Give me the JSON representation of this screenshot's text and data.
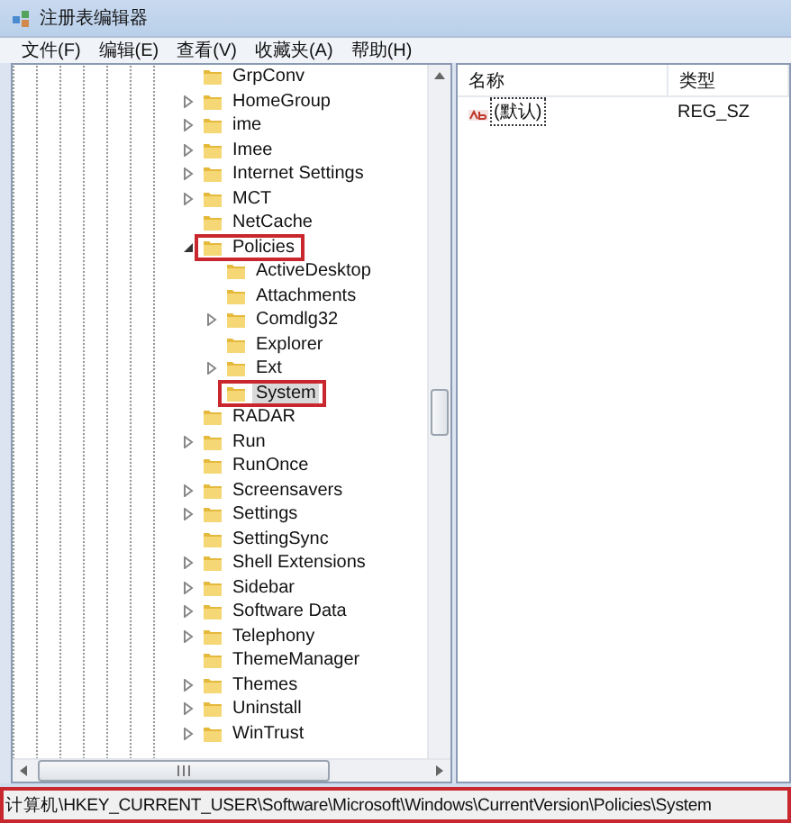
{
  "window": {
    "title": "注册表编辑器"
  },
  "menu": [
    "文件(F)",
    "编辑(E)",
    "查看(V)",
    "收藏夹(A)",
    "帮助(H)"
  ],
  "tree": [
    {
      "label": "GrpConv",
      "expandable": false,
      "selected": false,
      "highlighted": false
    },
    {
      "label": "HomeGroup",
      "expandable": true,
      "expanded": false,
      "selected": false,
      "highlighted": false
    },
    {
      "label": "ime",
      "expandable": true,
      "expanded": false,
      "selected": false,
      "highlighted": false
    },
    {
      "label": "Imee",
      "expandable": true,
      "expanded": false,
      "selected": false,
      "highlighted": false
    },
    {
      "label": "Internet Settings",
      "expandable": true,
      "expanded": false,
      "selected": false,
      "highlighted": false
    },
    {
      "label": "MCT",
      "expandable": true,
      "expanded": false,
      "selected": false,
      "highlighted": false
    },
    {
      "label": "NetCache",
      "expandable": false,
      "selected": false,
      "highlighted": false
    },
    {
      "label": "Policies",
      "expandable": true,
      "expanded": true,
      "selected": false,
      "highlighted": true,
      "children": [
        {
          "label": "ActiveDesktop",
          "expandable": false,
          "selected": false,
          "highlighted": false
        },
        {
          "label": "Attachments",
          "expandable": false,
          "selected": false,
          "highlighted": false
        },
        {
          "label": "Comdlg32",
          "expandable": true,
          "expanded": false,
          "selected": false,
          "highlighted": false
        },
        {
          "label": "Explorer",
          "expandable": false,
          "selected": false,
          "highlighted": false
        },
        {
          "label": "Ext",
          "expandable": true,
          "expanded": false,
          "selected": false,
          "highlighted": false
        },
        {
          "label": "System",
          "expandable": false,
          "selected": true,
          "highlighted": true
        }
      ]
    },
    {
      "label": "RADAR",
      "expandable": false,
      "selected": false,
      "highlighted": false
    },
    {
      "label": "Run",
      "expandable": true,
      "expanded": false,
      "selected": false,
      "highlighted": false
    },
    {
      "label": "RunOnce",
      "expandable": false,
      "selected": false,
      "highlighted": false
    },
    {
      "label": "Screensavers",
      "expandable": true,
      "expanded": false,
      "selected": false,
      "highlighted": false
    },
    {
      "label": "Settings",
      "expandable": true,
      "expanded": false,
      "selected": false,
      "highlighted": false
    },
    {
      "label": "SettingSync",
      "expandable": false,
      "selected": false,
      "highlighted": false
    },
    {
      "label": "Shell Extensions",
      "expandable": true,
      "expanded": false,
      "selected": false,
      "highlighted": false
    },
    {
      "label": "Sidebar",
      "expandable": true,
      "expanded": false,
      "selected": false,
      "highlighted": false
    },
    {
      "label": "Software Data",
      "expandable": true,
      "expanded": false,
      "selected": false,
      "highlighted": false
    },
    {
      "label": "Telephony",
      "expandable": true,
      "expanded": false,
      "selected": false,
      "highlighted": false
    },
    {
      "label": "ThemeManager",
      "expandable": false,
      "selected": false,
      "highlighted": false
    },
    {
      "label": "Themes",
      "expandable": true,
      "expanded": false,
      "selected": false,
      "highlighted": false
    },
    {
      "label": "Uninstall",
      "expandable": true,
      "expanded": false,
      "selected": false,
      "highlighted": false
    },
    {
      "label": "WinTrust",
      "expandable": true,
      "expanded": false,
      "selected": false,
      "highlighted": false
    }
  ],
  "values": {
    "columns": [
      "名称",
      "类型"
    ],
    "rows": [
      {
        "name": "(默认)",
        "type": "REG_SZ",
        "focused": true
      }
    ]
  },
  "status_bar": {
    "path": "计算机\\HKEY_CURRENT_USER\\Software\\Microsoft\\Windows\\CurrentVersion\\Policies\\System",
    "highlighted": true
  }
}
